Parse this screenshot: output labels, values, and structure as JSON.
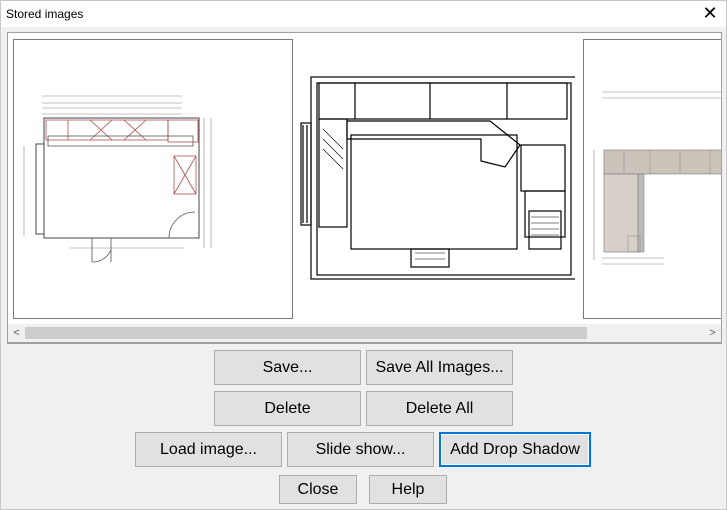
{
  "window": {
    "title": "Stored images",
    "close_glyph": "✕"
  },
  "gallery": {
    "thumbnails": [
      {
        "name": "floor-plan-thumbnail",
        "selected": false
      },
      {
        "name": "3d-plan-view-thumbnail",
        "selected": false
      },
      {
        "name": "elevation-thumbnail",
        "selected": false
      }
    ],
    "scroll_left_glyph": "<",
    "scroll_right_glyph": ">"
  },
  "buttons": {
    "save": "Save...",
    "save_all": "Save All Images...",
    "delete": "Delete",
    "delete_all": "Delete All",
    "load_image": "Load image...",
    "slide_show": "Slide show...",
    "add_drop_shadow": "Add Drop Shadow",
    "close": "Close",
    "help": "Help"
  },
  "colors": {
    "accent": "#0078d7",
    "button_face": "#e1e1e1",
    "dialog_bg": "#f0f0f0"
  }
}
